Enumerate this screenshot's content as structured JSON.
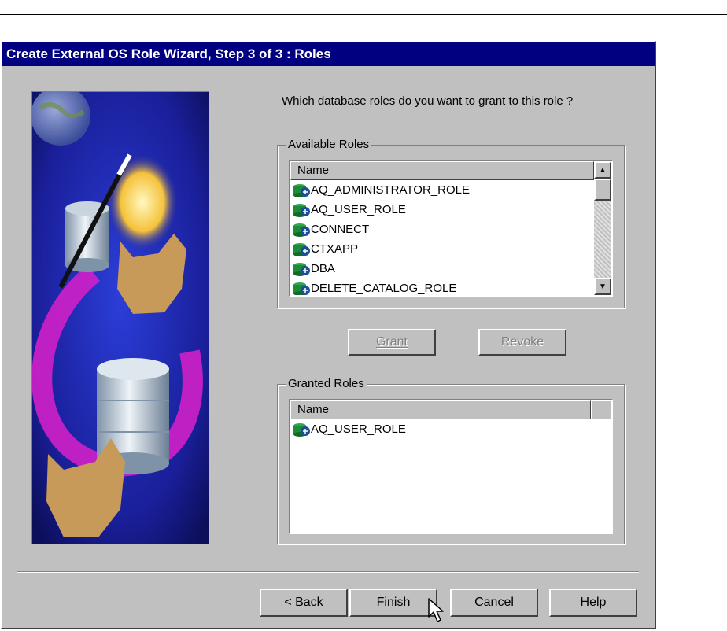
{
  "window": {
    "title": "Create External OS Role Wizard, Step 3 of 3 : Roles"
  },
  "prompt": "Which database roles do you want to grant to this role ?",
  "available": {
    "group_label": "Available Roles",
    "column_header": "Name",
    "items": [
      "AQ_ADMINISTRATOR_ROLE",
      "AQ_USER_ROLE",
      "CONNECT",
      "CTXAPP",
      "DBA",
      "DELETE_CATALOG_ROLE"
    ]
  },
  "actions": {
    "grant": "Grant",
    "revoke": "Revoke"
  },
  "granted": {
    "group_label": "Granted Roles",
    "column_header": "Name",
    "items": [
      "AQ_USER_ROLE"
    ]
  },
  "footer": {
    "back": "< Back",
    "finish": "Finish",
    "cancel": "Cancel",
    "help": "Help"
  },
  "icons": {
    "role": "role-icon",
    "scroll_up": "scroll-up-icon",
    "scroll_down": "scroll-down-icon",
    "cursor": "mouse-pointer-icon"
  },
  "colors": {
    "titlebar": "#000080",
    "dialog": "#c0c0c0"
  }
}
